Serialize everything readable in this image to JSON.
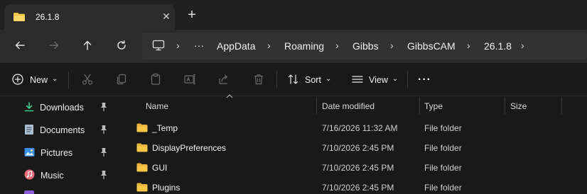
{
  "tab": {
    "title": "26.1.8",
    "close_glyph": "✕",
    "new_tab_glyph": "+"
  },
  "nav": {
    "back_icon": "arrow-left-icon",
    "forward_icon": "arrow-right-icon",
    "up_icon": "arrow-up-icon",
    "refresh_icon": "refresh-icon"
  },
  "address": {
    "overflow": "···",
    "crumbs": [
      "AppData",
      "Roaming",
      "Gibbs",
      "GibbsCAM",
      "26.1.8"
    ],
    "separator": "›"
  },
  "toolbar": {
    "new_label": "New",
    "sort_label": "Sort",
    "view_label": "View",
    "more_glyph": "···",
    "chevron": "⌄"
  },
  "sidebar": {
    "items": [
      {
        "label": "Downloads",
        "icon": "download-icon"
      },
      {
        "label": "Documents",
        "icon": "document-icon"
      },
      {
        "label": "Pictures",
        "icon": "pictures-icon"
      },
      {
        "label": "Music",
        "icon": "music-icon"
      }
    ]
  },
  "columns": {
    "name": "Name",
    "date": "Date modified",
    "type": "Type",
    "size": "Size"
  },
  "files": [
    {
      "name": "_Temp",
      "date": "7/16/2026 11:32 AM",
      "type": "File folder"
    },
    {
      "name": "DisplayPreferences",
      "date": "7/10/2026 2:45 PM",
      "type": "File folder"
    },
    {
      "name": "GUI",
      "date": "7/10/2026 2:45 PM",
      "type": "File folder"
    },
    {
      "name": "Plugins",
      "date": "7/10/2026 2:45 PM",
      "type": "File folder"
    }
  ],
  "colors": {
    "folder": "#f8c74a",
    "accent": "#60cdff"
  }
}
